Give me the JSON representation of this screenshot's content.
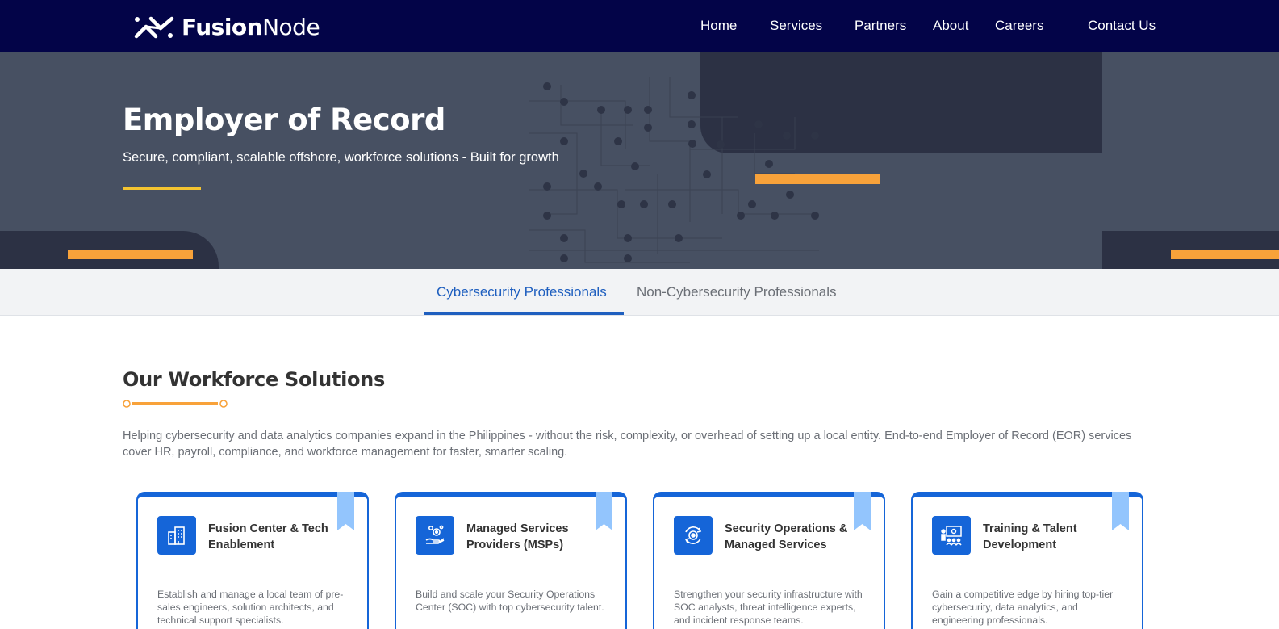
{
  "brand": {
    "name_bold": "Fusion",
    "name_thin": "Node"
  },
  "nav": {
    "home": "Home",
    "services": "Services",
    "partners": "Partners",
    "about": "About",
    "careers": "Careers",
    "contact": "Contact Us"
  },
  "hero": {
    "title": "Employer of Record",
    "subtitle": "Secure, compliant, scalable offshore, workforce solutions - Built for growth"
  },
  "tabs": {
    "active": "Cybersecurity Professionals",
    "inactive": "Non-Cybersecurity Professionals"
  },
  "section": {
    "title": "Our Workforce Solutions",
    "description": "Helping cybersecurity and data analytics companies expand in the Philippines - without the risk, complexity, or overhead of setting up a local entity. End-to-end Employer of Record (EOR) services cover HR, payroll, compliance, and workforce management for faster, smarter scaling."
  },
  "cards": [
    {
      "title": "Fusion Center & Tech Enablement",
      "text": "Establish and manage a local team of pre-sales engineers, solution architects, and technical support specialists.",
      "icon": "building-icon"
    },
    {
      "title": "Managed Services Providers (MSPs)",
      "text": "Build and scale your Security Operations Center (SOC) with top cybersecurity talent.",
      "icon": "gears-hand-icon"
    },
    {
      "title": "Security Operations & Managed Services",
      "text": "Strengthen your security infrastructure with SOC analysts, threat intelligence experts, and incident response teams.",
      "icon": "gear-refresh-icon"
    },
    {
      "title": "Training & Talent Development",
      "text": "Gain a competitive edge by hiring top-tier cybersecurity, data analytics, and engineering professionals.",
      "icon": "training-icon"
    }
  ],
  "colors": {
    "nav_bg": "#030448",
    "hero_bg": "#475062",
    "hero_dark": "#2c3144",
    "accent_orange": "#f8a23a",
    "accent_yellow": "#f4c430",
    "primary_blue": "#1565d8",
    "ribbon_blue": "#93c5fd"
  }
}
